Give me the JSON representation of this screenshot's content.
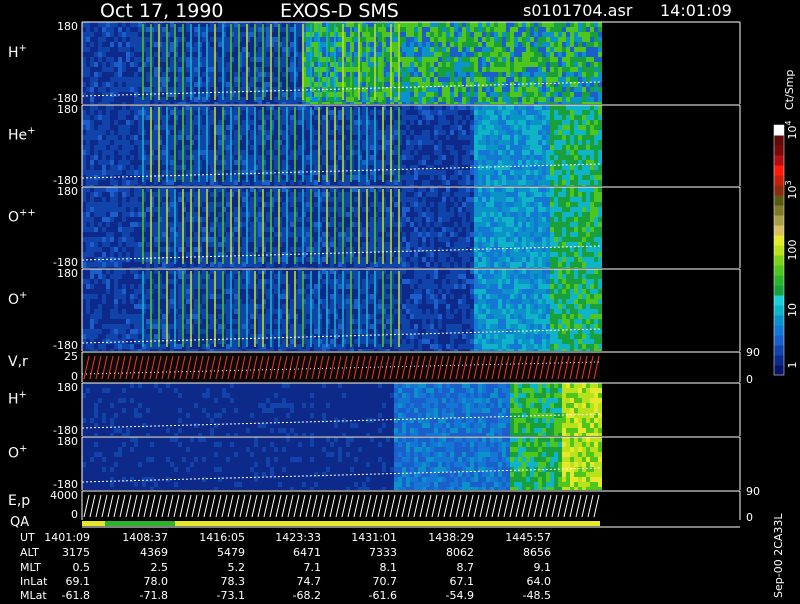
{
  "header": {
    "date": "Oct 17, 1990",
    "instrument": "EXOS-D SMS",
    "file": "s0101704.asr",
    "time": "14:01:09"
  },
  "colorbar": {
    "unit": "Ct/Smp",
    "tick_labels": [
      "1",
      "10",
      "100",
      "10",
      "10"
    ],
    "tick_exponents": [
      "",
      "",
      "",
      "3",
      "4"
    ],
    "levels": [
      "#0a1466",
      "#0d2a8a",
      "#1144aa",
      "#1a5fcc",
      "#1477d6",
      "#0b92c8",
      "#10b4c8",
      "#1ad0d8",
      "#19a03a",
      "#2bb52c",
      "#4ec61e",
      "#7ed31a",
      "#b9e11c",
      "#e6e92a",
      "#d8c060",
      "#a8a048",
      "#7e7a2a",
      "#5a5a10",
      "#8a2a10",
      "#c81e0a",
      "#ff1a0a",
      "#b01010",
      "#7a0a0a",
      "#600a0a",
      "#ffffff"
    ]
  },
  "panels": [
    {
      "label": "H",
      "charge": "+",
      "ytop": "180",
      "ybot": "-180"
    },
    {
      "label": "He",
      "charge": "+",
      "ytop": "180",
      "ybot": "-180"
    },
    {
      "label": "O",
      "charge": "++",
      "ytop": "180",
      "ybot": "-180"
    },
    {
      "label": "O",
      "charge": "+",
      "ytop": "180",
      "ybot": "-180"
    },
    {
      "label": "V,r",
      "charge": "",
      "ytop": "25",
      "ybot": "0",
      "rtop": "90",
      "rbot": "0"
    },
    {
      "label": "H",
      "charge": "+",
      "ytop": "180",
      "ybot": "-180"
    },
    {
      "label": "O",
      "charge": "+",
      "ytop": "180",
      "ybot": "-180"
    },
    {
      "label": "E,p",
      "charge": "",
      "ytop": "4000",
      "ybot": "0",
      "rtop": "90",
      "rbot": "0"
    }
  ],
  "qa_label": "QA",
  "footer": {
    "row_labels": [
      "UT",
      "ALT",
      "MLT",
      "InLat",
      "MLat"
    ],
    "columns": [
      [
        "1401:09",
        "3175",
        "0.5",
        "69.1",
        "-61.8"
      ],
      [
        "1408:37",
        "4369",
        "2.5",
        "78.0",
        "-71.8"
      ],
      [
        "1416:05",
        "5479",
        "5.2",
        "78.3",
        "-73.1"
      ],
      [
        "1423:33",
        "6471",
        "7.1",
        "74.7",
        "-68.2"
      ],
      [
        "1431:01",
        "7333",
        "8.1",
        "70.7",
        "-61.6"
      ],
      [
        "1438:29",
        "8062",
        "8.7",
        "67.1",
        "-54.9"
      ],
      [
        "1445:57",
        "8656",
        "9.1",
        "64.0",
        "-48.5"
      ]
    ]
  },
  "side_note": "Sep-00  2CA33L",
  "chart_data": {
    "type": "heatmap",
    "title": "Oct 17, 1990   EXOS-D SMS",
    "xlabel": "UT",
    "x_ticks": [
      "1401:09",
      "1408:37",
      "1416:05",
      "1423:33",
      "1431:01",
      "1438:29",
      "1445:57"
    ],
    "colorbar_label": "Ct/Smp",
    "colorbar_range": [
      1,
      10000
    ],
    "colorbar_scale": "log",
    "series": [
      {
        "name": "H+",
        "ylim": [
          -180,
          180
        ]
      },
      {
        "name": "He+",
        "ylim": [
          -180,
          180
        ]
      },
      {
        "name": "O++",
        "ylim": [
          -180,
          180
        ]
      },
      {
        "name": "O+",
        "ylim": [
          -180,
          180
        ]
      },
      {
        "name": "V,r",
        "ylim": [
          0,
          25
        ],
        "y2lim": [
          0,
          90
        ]
      },
      {
        "name": "H+",
        "ylim": [
          -180,
          180
        ]
      },
      {
        "name": "O+",
        "ylim": [
          -180,
          180
        ]
      },
      {
        "name": "E,p",
        "ylim": [
          0,
          4000
        ],
        "y2lim": [
          0,
          90
        ]
      }
    ],
    "grid": false
  }
}
